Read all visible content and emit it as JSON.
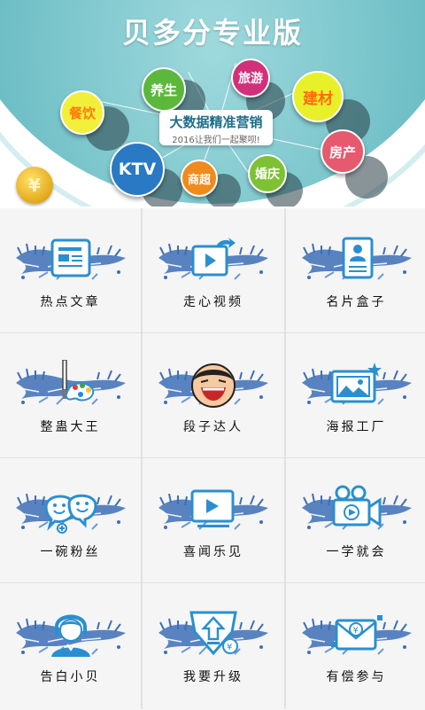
{
  "banner": {
    "title": "贝多分专业版",
    "center_title": "大数据精准营销",
    "center_subtitle": "2016让我们一起聚呗!",
    "coin_symbol": "¥",
    "bubbles": [
      {
        "label": "养生",
        "color": "#5cb83a"
      },
      {
        "label": "旅游",
        "color": "#d2307a"
      },
      {
        "label": "建材",
        "color": "#ff6a10"
      },
      {
        "label": "餐饮",
        "color": "#ff7d10"
      },
      {
        "label": "房产",
        "color": "#e55a6e"
      },
      {
        "label": "KTV",
        "color": "#2a79c4"
      },
      {
        "label": "商超",
        "color": "#f08a1c"
      },
      {
        "label": "婚庆",
        "color": "#7ec134"
      }
    ]
  },
  "menu": {
    "items": [
      {
        "label": "热点文章",
        "icon": "article-icon"
      },
      {
        "label": "走心视频",
        "icon": "video-share-icon"
      },
      {
        "label": "名片盒子",
        "icon": "business-card-icon"
      },
      {
        "label": "整蛊大王",
        "icon": "paint-palette-icon"
      },
      {
        "label": "段子达人",
        "icon": "laughing-face-icon"
      },
      {
        "label": "海报工厂",
        "icon": "poster-image-icon"
      },
      {
        "label": "一碗粉丝",
        "icon": "fans-chat-icon"
      },
      {
        "label": "喜闻乐见",
        "icon": "video-player-icon"
      },
      {
        "label": "一学就会",
        "icon": "video-camera-icon"
      },
      {
        "label": "告白小贝",
        "icon": "customer-service-icon"
      },
      {
        "label": "我要升级",
        "icon": "upgrade-diamond-icon"
      },
      {
        "label": "有偿参与",
        "icon": "paid-envelope-icon"
      }
    ]
  },
  "colors": {
    "icon_blue": "#2a8fd0",
    "splash_blue": "#3d6fb6",
    "cell_bg": "#f5f5f5",
    "divider": "#e1e1e1",
    "banner_teal": "#6fbfc6"
  }
}
